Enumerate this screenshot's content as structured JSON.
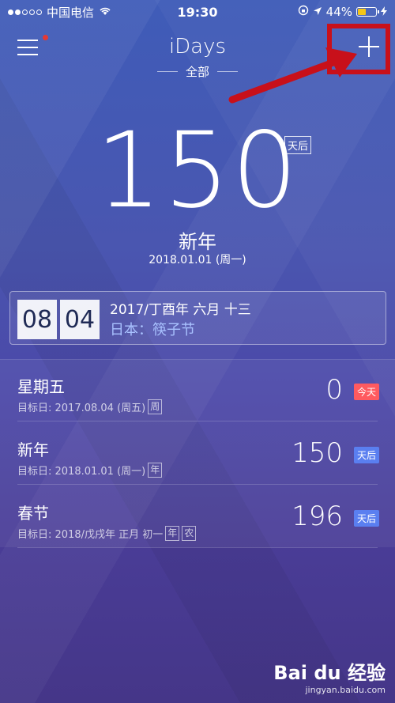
{
  "status_bar": {
    "carrier": "中国电信",
    "time": "19:30",
    "battery": "44%",
    "battery_level": 0.44
  },
  "nav": {
    "title": "iDays",
    "filter": "全部"
  },
  "hero": {
    "count": "150",
    "unit": "天后",
    "name": "新年",
    "date": "2018.01.01 (周一)"
  },
  "today": {
    "month": "08",
    "day": "04",
    "lunar": "2017/丁酉年 六月 十三",
    "holiday": "日本：筷子节"
  },
  "events": [
    {
      "name": "星期五",
      "target": "目标日: 2017.08.04 (周五)",
      "tags": [
        "周"
      ],
      "count": "0",
      "badge": "今天",
      "badge_color": "#ff5a5f"
    },
    {
      "name": "新年",
      "target": "目标日: 2018.01.01 (周一)",
      "tags": [
        "年"
      ],
      "count": "150",
      "badge": "天后",
      "badge_color": "#5a7ff0"
    },
    {
      "name": "春节",
      "target": "目标日: 2018/戊戌年 正月 初一",
      "tags": [
        "年",
        "农"
      ],
      "count": "196",
      "badge": "天后",
      "badge_color": "#5a7ff0"
    }
  ],
  "watermark": {
    "logo": "Bai du 经验",
    "url": "jingyan.baidu.com"
  },
  "colors": {
    "annotation": "#c8101a"
  }
}
